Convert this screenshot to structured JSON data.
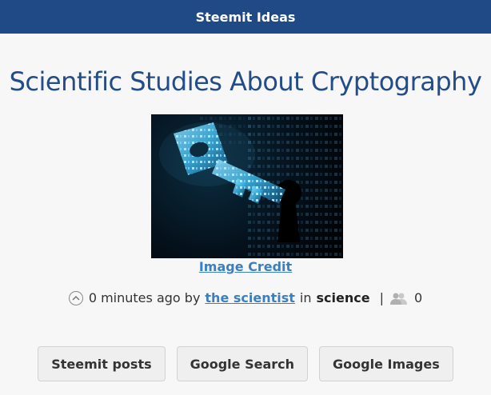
{
  "header": {
    "title": "Steemit Ideas"
  },
  "post": {
    "title": "Scientific Studies About Cryptography",
    "image_credit_label": "Image Credit",
    "time_ago": "0 minutes ago by",
    "author": "the scientist",
    "in_label": "in",
    "category": "science",
    "separator": "|",
    "voter_count": "0"
  },
  "actions": {
    "steemit_posts": "Steemit posts",
    "google_search": "Google Search",
    "google_images": "Google Images"
  },
  "colors": {
    "header_bg": "#1f4a85",
    "title": "#224d88",
    "link": "#3b7fc0",
    "page_bg": "#f7f7f7"
  },
  "icons": {
    "upvote": "chevron-up-circle-icon",
    "voters": "users-icon"
  },
  "hero_image": {
    "subject": "digital key made of glowing binary/hex code over dark keyhole"
  }
}
